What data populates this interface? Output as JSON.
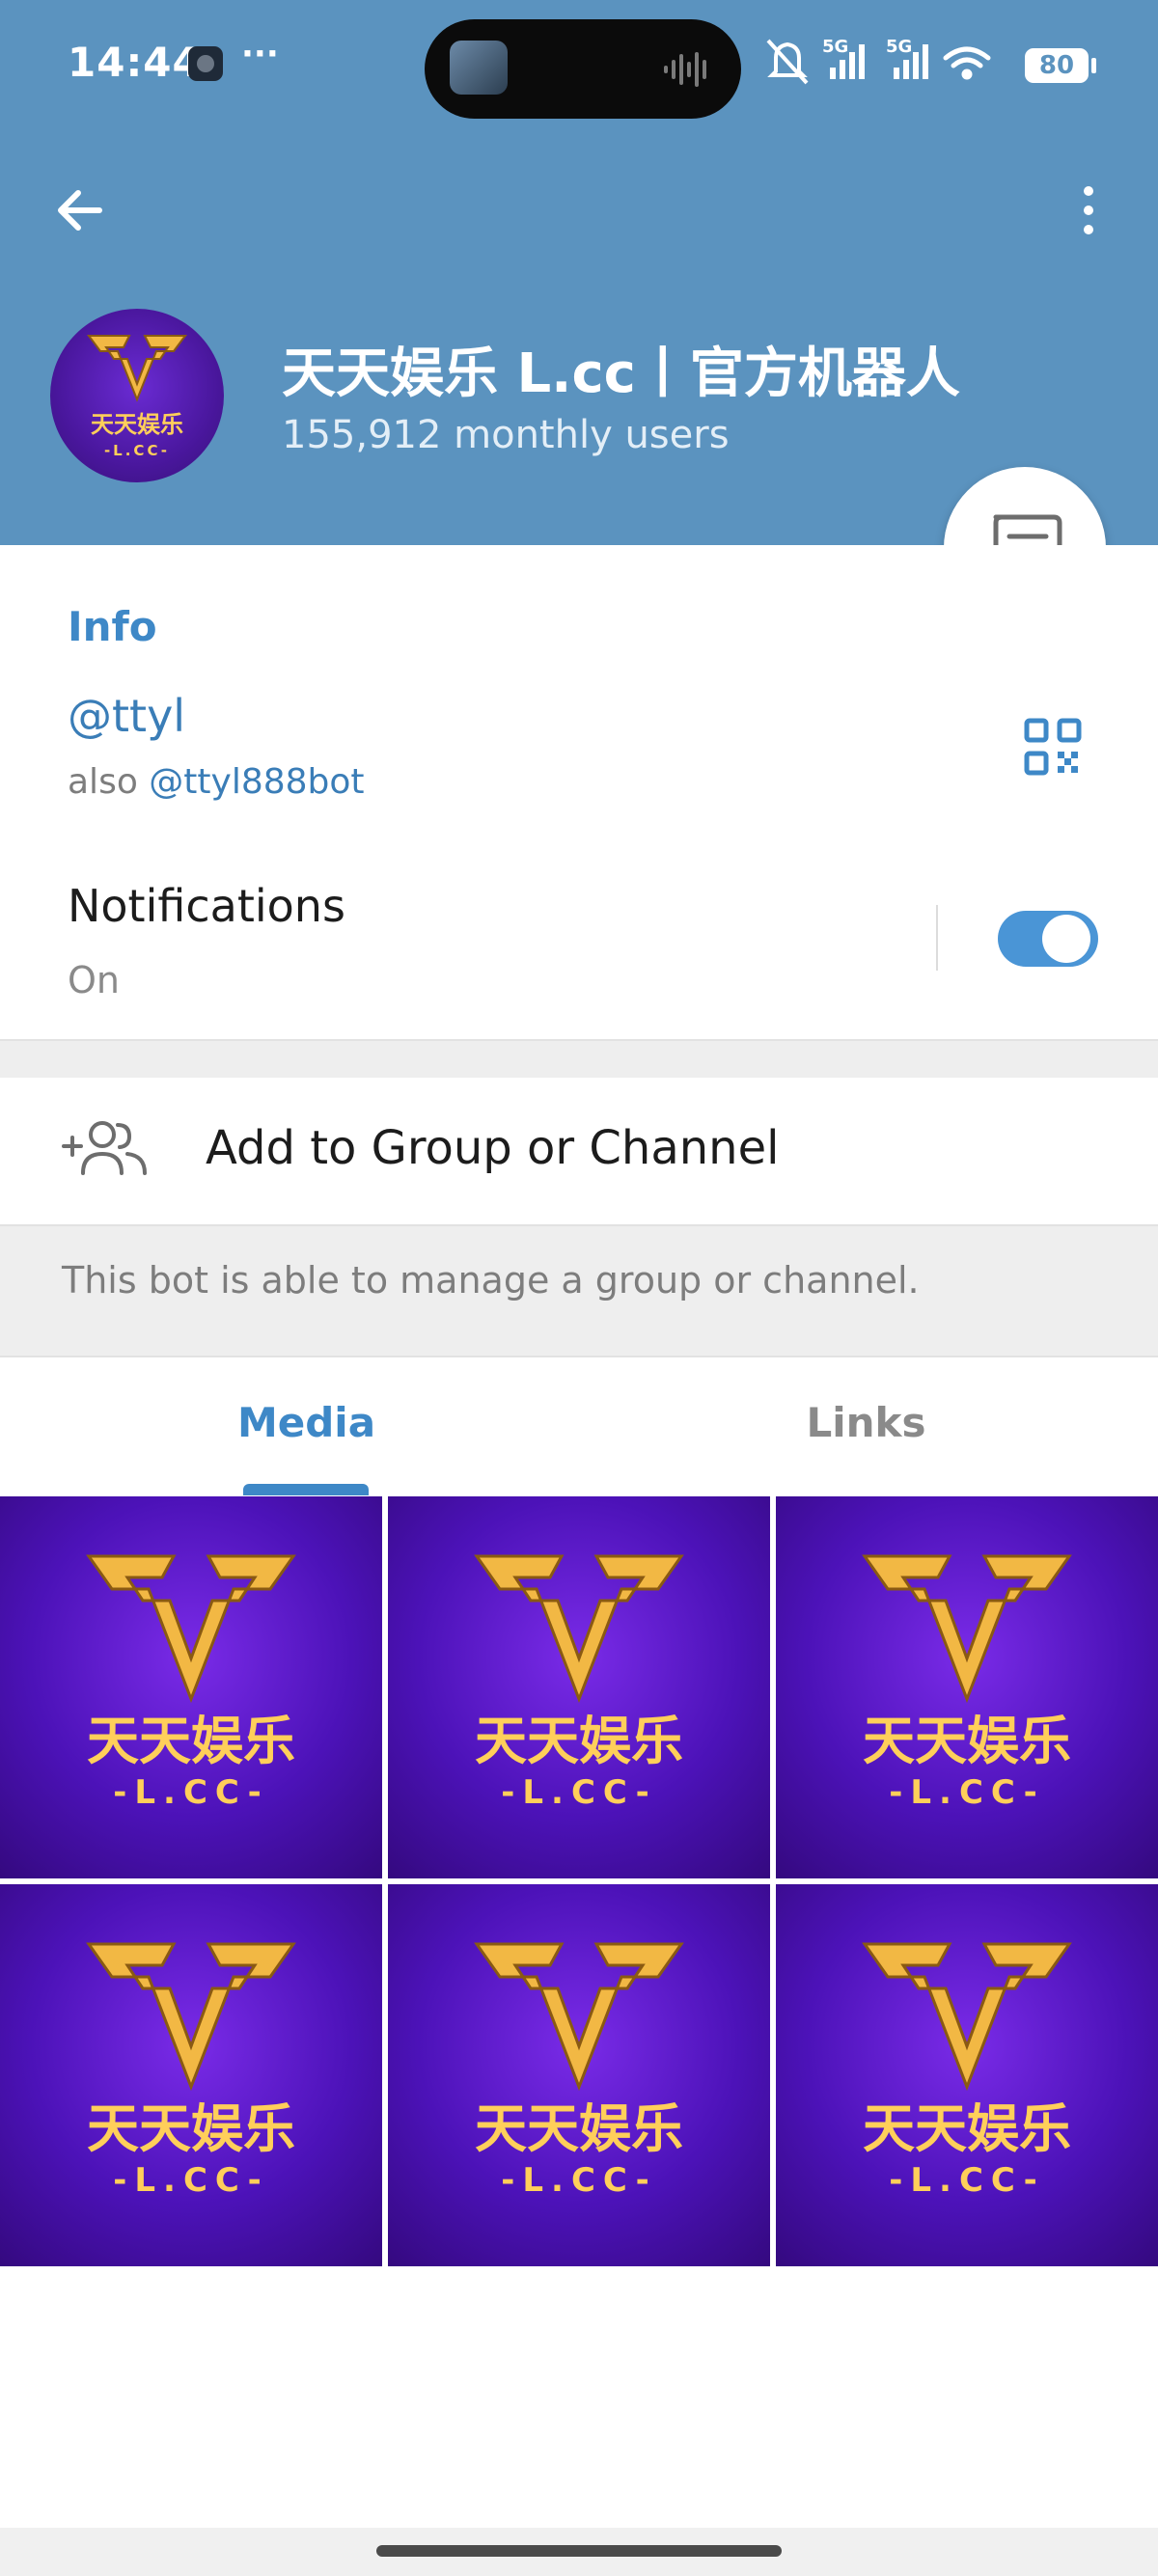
{
  "status_bar": {
    "time": "14:44",
    "dots": "···",
    "battery": "80",
    "network_labels": [
      "5G",
      "5G"
    ]
  },
  "header": {
    "bot_name": "天天娱乐 L.cc丨官方机器人",
    "monthly_users": "155,912 monthly users",
    "avatar_logo_text": "天天娱乐",
    "avatar_logo_sub": "-L.CC-"
  },
  "info": {
    "section_title": "Info",
    "username": "@ttyl",
    "also_prefix": "also",
    "also_username": "@ttyl888bot",
    "notifications_label": "Notifications",
    "notifications_state": "On",
    "notifications_enabled": true
  },
  "actions": {
    "add_to_group_label": "Add to Group or Channel",
    "bot_note": "This bot is able to manage a group or channel."
  },
  "tabs": {
    "media": "Media",
    "links": "Links",
    "active": "Media"
  },
  "media": {
    "items": [
      {
        "logo_text": "天天娱乐",
        "logo_sub": "-L.CC-"
      },
      {
        "logo_text": "天天娱乐",
        "logo_sub": "-L.CC-"
      },
      {
        "logo_text": "天天娱乐",
        "logo_sub": "-L.CC-"
      },
      {
        "logo_text": "天天娱乐",
        "logo_sub": "-L.CC-"
      },
      {
        "logo_text": "天天娱乐",
        "logo_sub": "-L.CC-"
      },
      {
        "logo_text": "天天娱乐",
        "logo_sub": "-L.CC-"
      }
    ]
  },
  "colors": {
    "header_blue": "#5b93bf",
    "accent_blue": "#3e88c7",
    "link_blue": "#3a7db7",
    "logo_gold": "#ffcf5a",
    "tile_purple": "#4c12b8"
  },
  "icons": {
    "back": "arrow-left-icon",
    "more": "more-vertical-icon",
    "message": "message-icon",
    "qr": "qr-code-icon",
    "add_group": "add-users-icon"
  }
}
